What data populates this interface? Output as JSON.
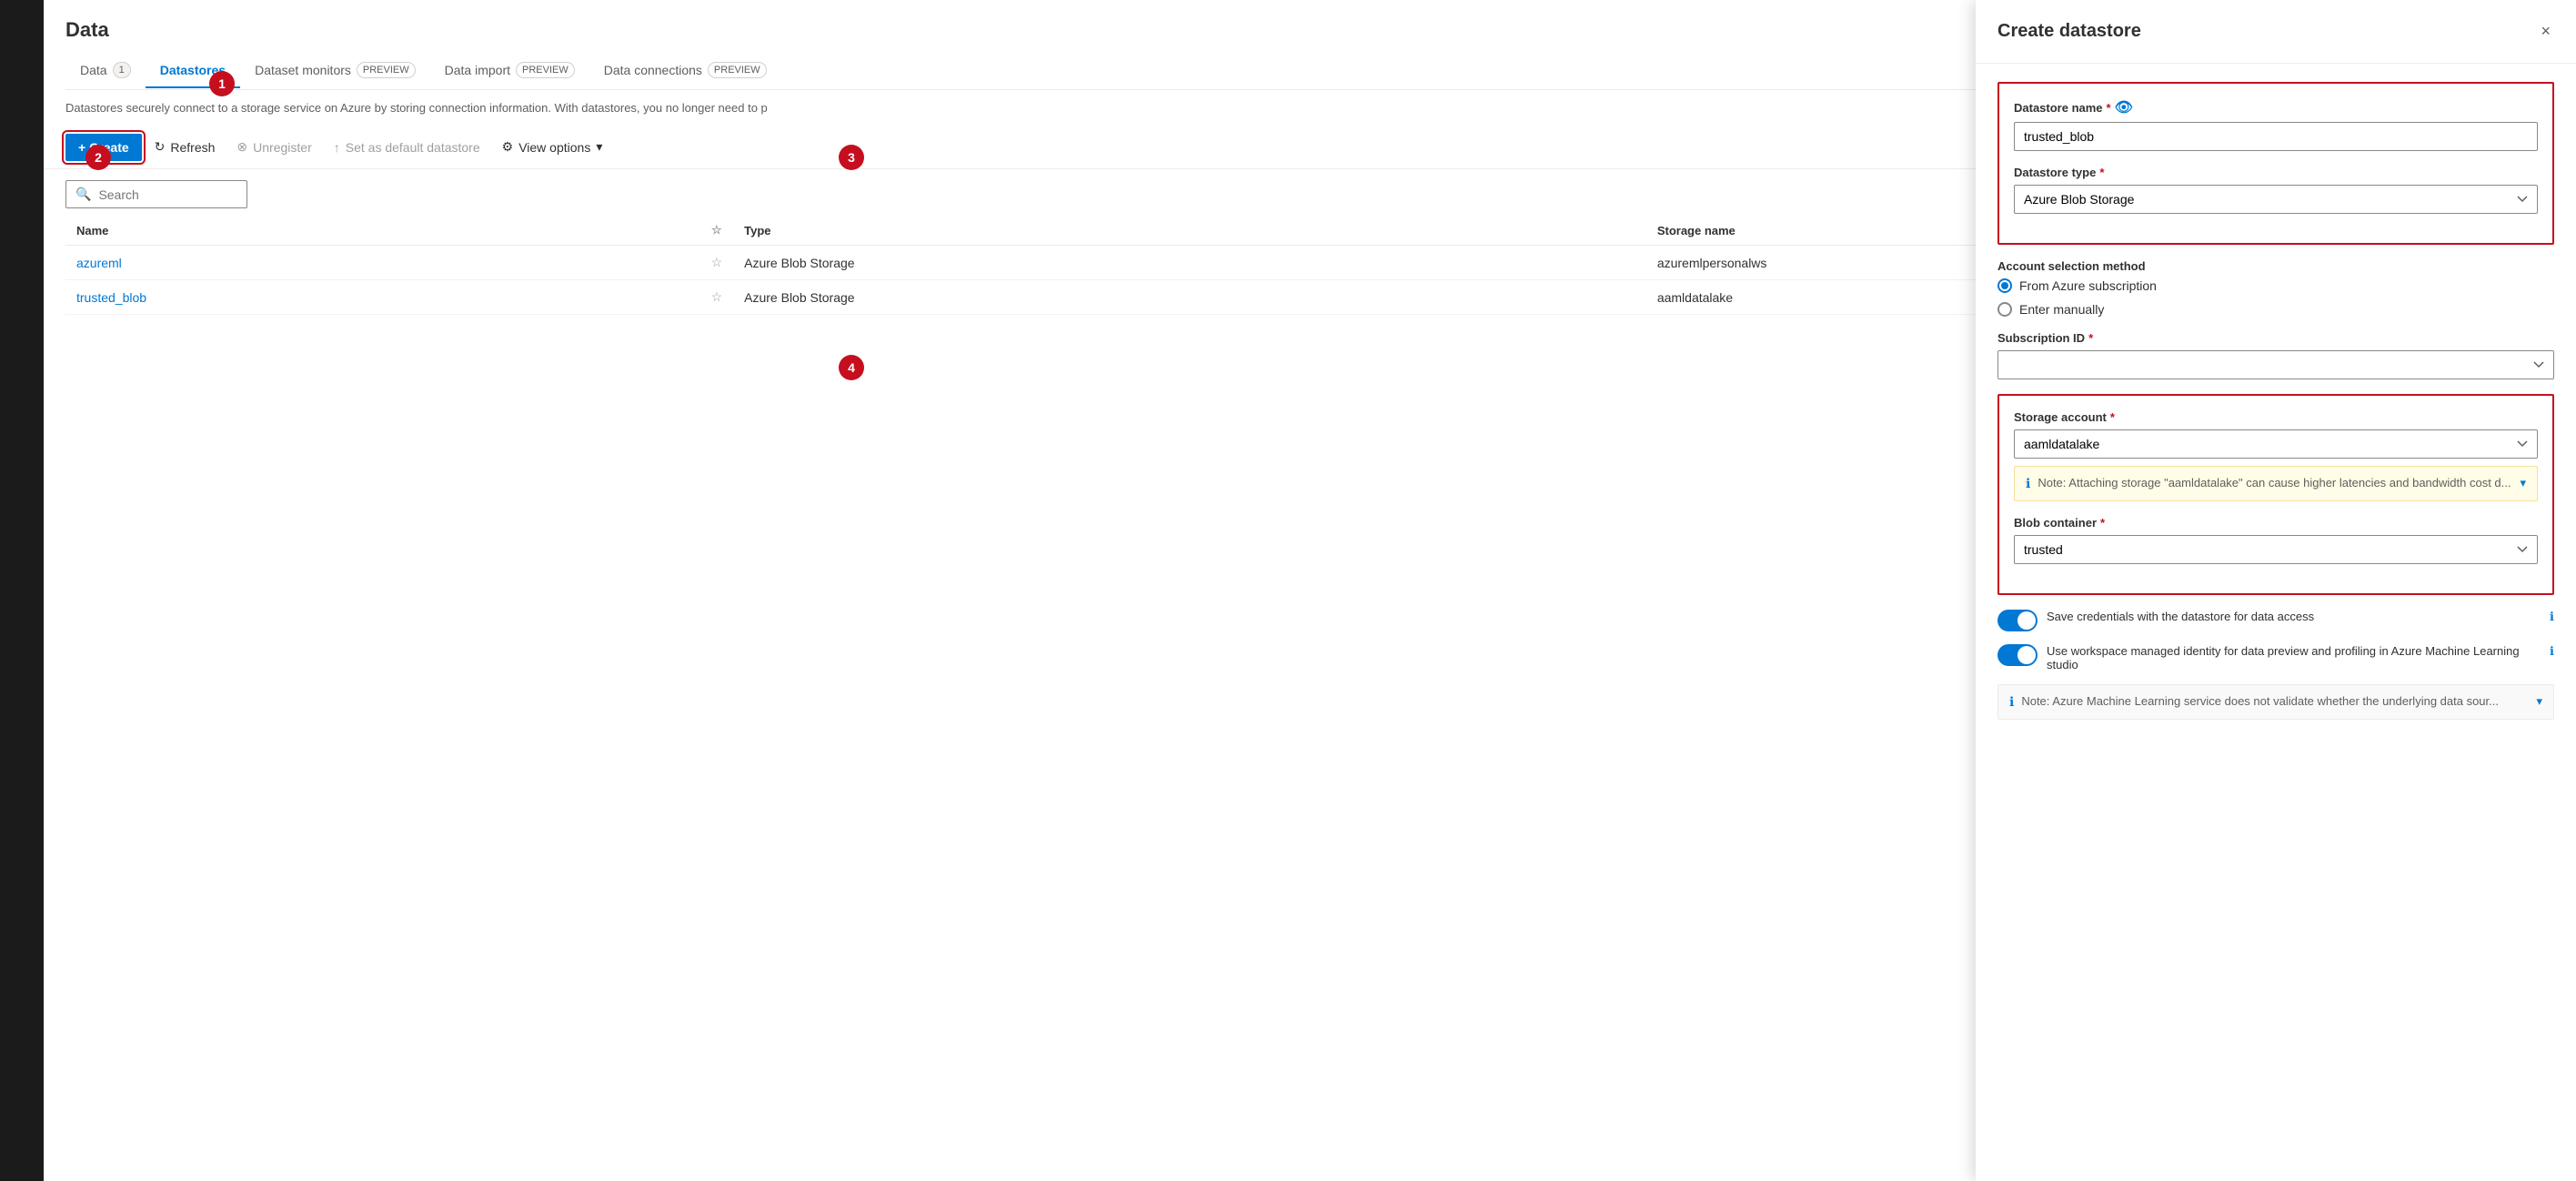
{
  "page": {
    "title": "Data",
    "description": "Datastores securely connect to a storage service on Azure by storing connection information. With datastores, you no longer need to p"
  },
  "tabs": [
    {
      "id": "data",
      "label": "Data",
      "badge": "1",
      "badge_type": "circle",
      "active": false
    },
    {
      "id": "datastores",
      "label": "Datastores",
      "badge": "",
      "badge_type": "",
      "active": true
    },
    {
      "id": "dataset-monitors",
      "label": "Dataset monitors",
      "badge": "PREVIEW",
      "badge_type": "outline",
      "active": false
    },
    {
      "id": "data-import",
      "label": "Data import",
      "badge": "PREVIEW",
      "badge_type": "outline",
      "active": false
    },
    {
      "id": "data-connections",
      "label": "Data connections",
      "badge": "PREVIEW",
      "badge_type": "outline",
      "active": false
    }
  ],
  "toolbar": {
    "create_label": "+ Create",
    "refresh_label": "Refresh",
    "unregister_label": "Unregister",
    "set_default_label": "Set as default datastore",
    "view_options_label": "View options"
  },
  "search": {
    "placeholder": "Search"
  },
  "table": {
    "columns": [
      "Name",
      "",
      "Type",
      "Storage name"
    ],
    "rows": [
      {
        "name": "azureml",
        "type": "Azure Blob Storage",
        "storage": "azuremlpersonalws"
      },
      {
        "name": "trusted_blob",
        "type": "Azure Blob Storage",
        "storage": "aamldatalake"
      }
    ]
  },
  "panel": {
    "title": "Create datastore",
    "close_label": "×",
    "datastore_name_label": "Datastore name",
    "datastore_name_value": "trusted_blob",
    "datastore_type_label": "Datastore type",
    "datastore_type_value": "Azure Blob Storage",
    "account_selection_label": "Account selection method",
    "from_azure_label": "From Azure subscription",
    "enter_manually_label": "Enter manually",
    "subscription_id_label": "Subscription ID",
    "storage_account_section": {
      "storage_account_label": "Storage account",
      "storage_account_value": "aamldatalake",
      "note_text": "Note: Attaching storage \"aamldatalake\" can cause higher latencies and bandwidth cost d...",
      "blob_container_label": "Blob container",
      "blob_container_value": "trusted"
    },
    "save_credentials_label": "Save credentials with the datastore for data access",
    "workspace_identity_label": "Use workspace managed identity for data preview and profiling in Azure Machine Learning studio",
    "bottom_note": "Note: Azure Machine Learning service does not validate whether the underlying data sour..."
  },
  "steps": {
    "step1": "1",
    "step2": "2",
    "step3": "3",
    "step4": "4"
  },
  "colors": {
    "accent": "#0078d4",
    "danger": "#c50f1f",
    "disabled": "#a19f9d"
  }
}
